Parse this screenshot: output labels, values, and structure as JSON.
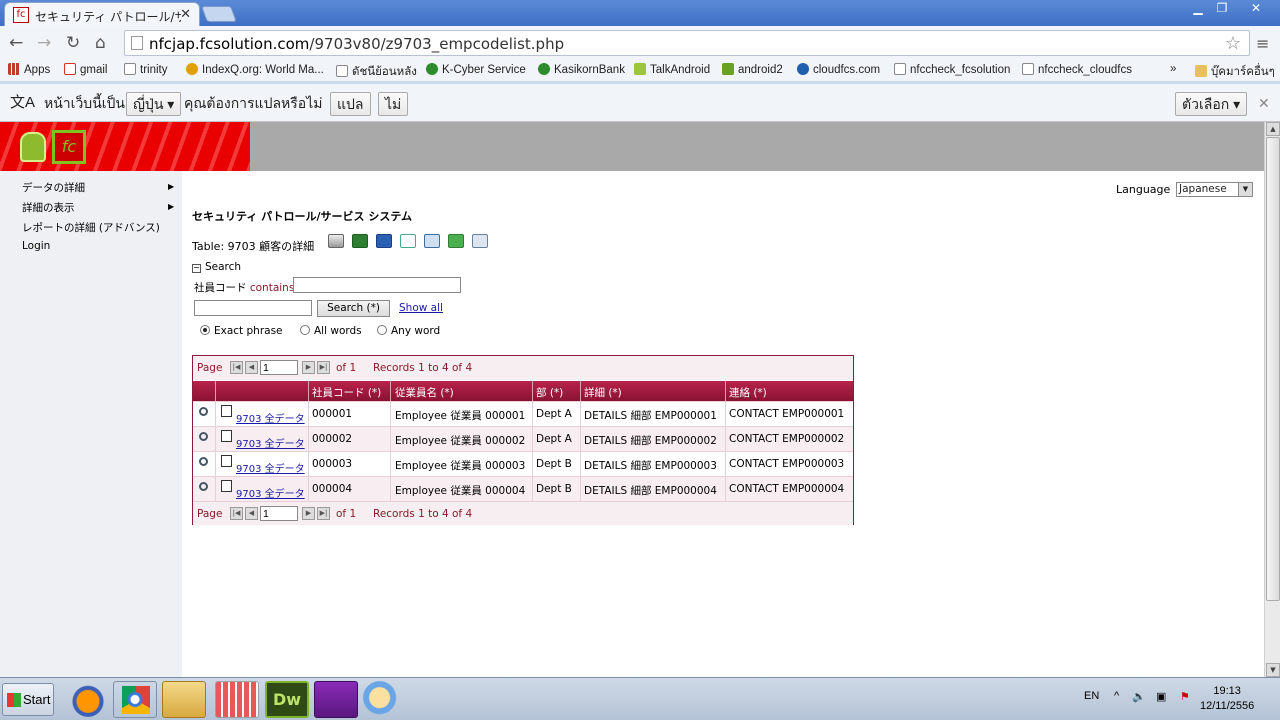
{
  "browser": {
    "tab_title": "セキュリティ パトロール/サ",
    "tab_favicon": "fc",
    "url_host": "nfcjap.fcsolution.com",
    "url_path": "/9703v80/z9703_empcodelist.php",
    "bookmarks": [
      {
        "label": "Apps",
        "icon": "apps-icon",
        "color": "#c0392b"
      },
      {
        "label": "gmail",
        "icon": "gmail-icon",
        "color": "#d93025"
      },
      {
        "label": "trinity",
        "icon": "page-icon",
        "color": "#888888"
      },
      {
        "label": "IndexQ.org: World Ma...",
        "icon": "indexq-icon",
        "color": "#e0a000"
      },
      {
        "label": "ดัชนีย้อนหลัง",
        "icon": "page-icon",
        "color": "#888888"
      },
      {
        "label": "K-Cyber Service",
        "icon": "kbank-icon",
        "color": "#2e8b2e"
      },
      {
        "label": "KasikornBank",
        "icon": "kbank-icon",
        "color": "#2e8b2e"
      },
      {
        "label": "TalkAndroid",
        "icon": "android-icon",
        "color": "#9bc53d"
      },
      {
        "label": "android2",
        "icon": "android-icon",
        "color": "#6aa121"
      },
      {
        "label": "cloudfcs.com",
        "icon": "cloud-icon",
        "color": "#1f5fae"
      },
      {
        "label": "nfccheck_fcsolution",
        "icon": "page-icon",
        "color": "#888888"
      },
      {
        "label": "nfccheck_cloudfcs",
        "icon": "page-icon",
        "color": "#888888"
      }
    ],
    "bookmarks_more": "»",
    "other_bookmarks": "บุ๊คมาร์คอื่นๆ"
  },
  "translate_bar": {
    "text1": "หน้าเว็บนี้เป็น",
    "language": "ญี่ปุ่น",
    "text2": "คุณต้องการแปลหรือไม่",
    "translate_btn": "แปล",
    "no_btn": "ไม่",
    "options_btn": "ตัวเลือก"
  },
  "sidebar": {
    "items": [
      {
        "label": "データの詳細",
        "has_submenu": true
      },
      {
        "label": "詳細の表示",
        "has_submenu": true
      },
      {
        "label": "レポートの詳細 (アドバンス)",
        "has_submenu": false
      },
      {
        "label": "Login",
        "has_submenu": false
      }
    ]
  },
  "language": {
    "label": "Language",
    "value": "Japanese"
  },
  "system_title": "セキュリティ パトロール/サービス システム",
  "table_title": "Table: 9703 顧客の詳細",
  "export_icons": [
    "print-icon",
    "excel-icon",
    "word-icon",
    "html-icon",
    "xml-icon",
    "csv-icon",
    "email-icon"
  ],
  "search": {
    "header": "Search",
    "toggle": "⊟",
    "field_label": "社員コード",
    "operator": "contains",
    "field_value": "",
    "query_value": "",
    "button": "Search (*)",
    "show_all": "Show all",
    "options": [
      {
        "label": "Exact phrase",
        "checked": true
      },
      {
        "label": "All words",
        "checked": false
      },
      {
        "label": "Any word",
        "checked": false
      }
    ]
  },
  "pager": {
    "page_label": "Page",
    "page_value": "1",
    "of_label": "of 1",
    "records": "Records 1 to 4 of 4"
  },
  "grid": {
    "columns": [
      "社員コード (*)",
      "従業員名 (*)",
      "部 (*)",
      "詳細 (*)",
      "連絡 (*)"
    ],
    "link_label": "9703 全データ",
    "rows": [
      {
        "code": "000001",
        "name": "Employee 従業員 000001",
        "dept": "Dept A",
        "details": "DETAILS 細部 EMP000001",
        "contact": "CONTACT EMP000001"
      },
      {
        "code": "000002",
        "name": "Employee 従業員 000002",
        "dept": "Dept A",
        "details": "DETAILS 細部 EMP000002",
        "contact": "CONTACT EMP000002"
      },
      {
        "code": "000003",
        "name": "Employee 従業員 000003",
        "dept": "Dept B",
        "details": "DETAILS 細部 EMP000003",
        "contact": "CONTACT EMP000003"
      },
      {
        "code": "000004",
        "name": "Employee 従業員 000004",
        "dept": "Dept B",
        "details": "DETAILS 細部 EMP000004",
        "contact": "CONTACT EMP000004"
      }
    ]
  },
  "taskbar": {
    "start": "Start",
    "apps": [
      "firefox-icon",
      "chrome-icon",
      "explorer-icon",
      "apps-grid-icon",
      "dreamweaver-icon",
      "visualstudio-icon",
      "paint-icon"
    ],
    "dw_label": "Dw",
    "lang": "EN",
    "time": "19:13",
    "date": "12/11/2556"
  },
  "colors": {
    "accent": "#8b1a3c",
    "header_grad_top": "#b8234b",
    "banner_red": "#e90000",
    "banner_gray": "#a9a9a9"
  }
}
